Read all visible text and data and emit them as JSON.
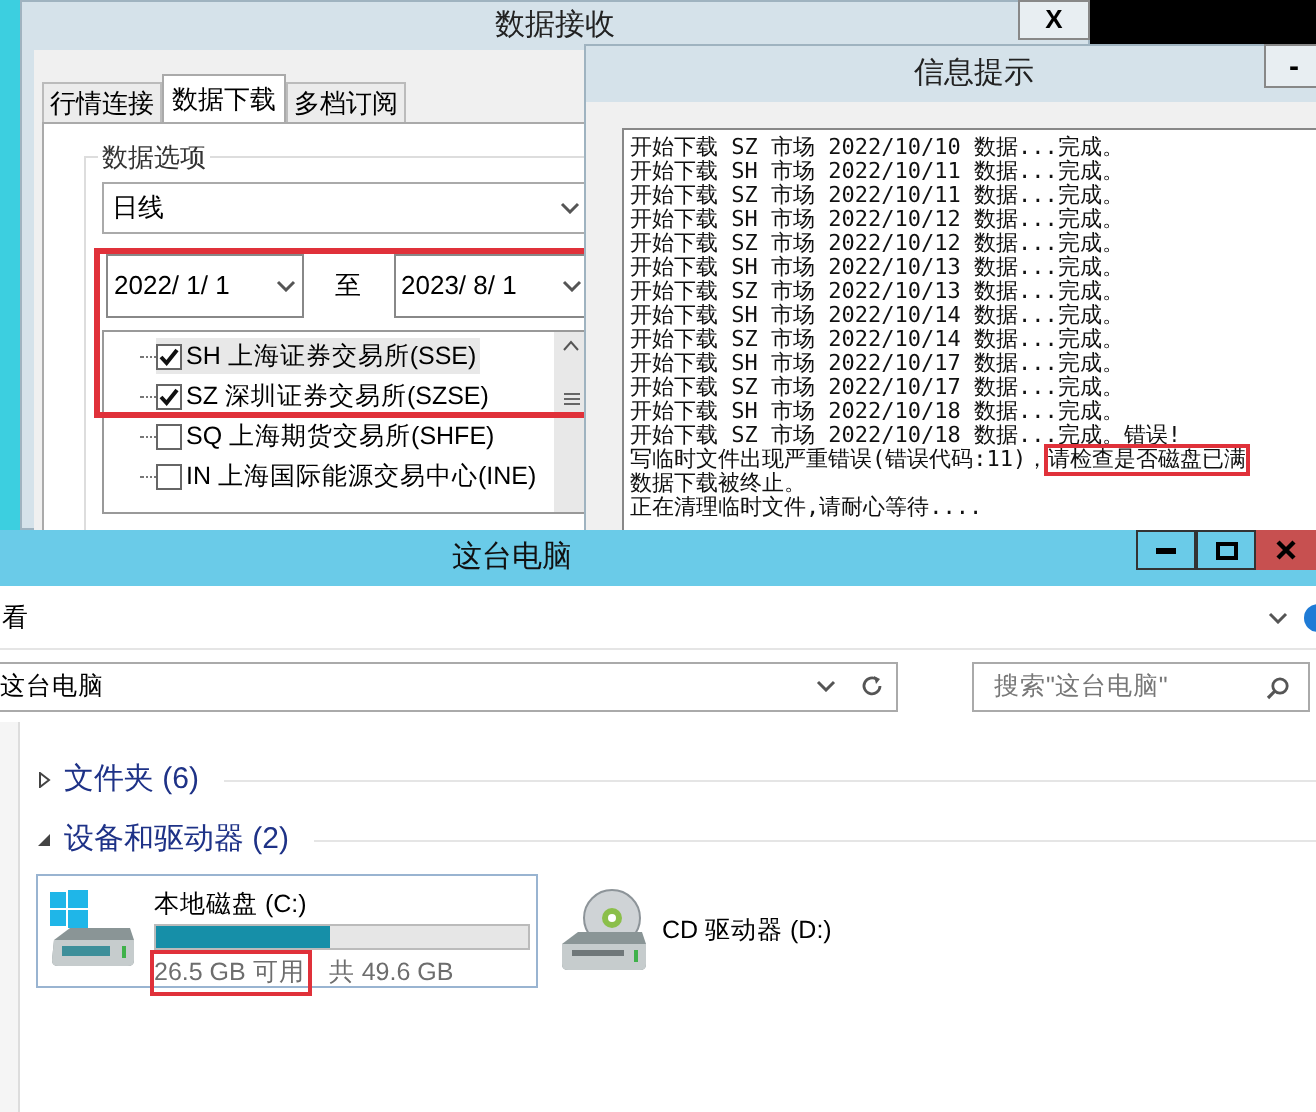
{
  "receive_dialog": {
    "title": "数据接收",
    "close": "X",
    "tabs": [
      {
        "label": "行情连接",
        "selected": false
      },
      {
        "label": "数据下载",
        "selected": true
      },
      {
        "label": "多档订阅",
        "selected": false
      }
    ],
    "group_title": "数据选项",
    "period": "日线",
    "start_date": "2022/ 1/ 1",
    "range_separator": "至",
    "end_date": "2023/ 8/ 1",
    "exchanges": [
      {
        "label": "SH 上海证券交易所(SSE)",
        "checked": true,
        "selected": true
      },
      {
        "label": "SZ 深圳证券交易所(SZSE)",
        "checked": true,
        "selected": false
      },
      {
        "label": "SQ 上海期货交易所(SHFE)",
        "checked": false,
        "selected": false
      },
      {
        "label": "IN 上海国际能源交易中心(INE)",
        "checked": false,
        "selected": false
      }
    ]
  },
  "info_window": {
    "title": "信息提示",
    "minimize": "-",
    "log_lines": [
      "开始下载 SZ 市场 2022/10/10 数据...完成。",
      "开始下载 SH 市场 2022/10/11 数据...完成。",
      "开始下载 SZ 市场 2022/10/11 数据...完成。",
      "开始下载 SH 市场 2022/10/12 数据...完成。",
      "开始下载 SZ 市场 2022/10/12 数据...完成。",
      "开始下载 SH 市场 2022/10/13 数据...完成。",
      "开始下载 SZ 市场 2022/10/13 数据...完成。",
      "开始下载 SH 市场 2022/10/14 数据...完成。",
      "开始下载 SZ 市场 2022/10/14 数据...完成。",
      "开始下载 SH 市场 2022/10/17 数据...完成。",
      "开始下载 SZ 市场 2022/10/17 数据...完成。",
      "开始下载 SH 市场 2022/10/18 数据...完成。",
      "开始下载 SZ 市场 2022/10/18 数据...完成。错误!"
    ],
    "error_line": "写临时文件出现严重错误(错误代码:11)，",
    "error_highlight": "请检查是否磁盘已满",
    "after_lines": [
      "数据下载被终止。",
      "正在清理临时文件,请耐心等待...."
    ]
  },
  "explorer": {
    "title": "这台电脑",
    "ribbon_tab": "看",
    "address": "这台电脑",
    "search": {
      "placeholder": "搜索\"这台电脑\""
    },
    "sections": [
      {
        "label": "文件夹 (6)",
        "expanded": false
      },
      {
        "label": "设备和驱动器 (2)",
        "expanded": true
      }
    ],
    "drives": [
      {
        "kind": "disk",
        "name": "本地磁盘 (C:)",
        "level": 0.466,
        "free": "26.5 GB 可用",
        "total": "共 49.6 GB"
      },
      {
        "kind": "cd",
        "name": "CD 驱动器 (D:)"
      }
    ]
  }
}
